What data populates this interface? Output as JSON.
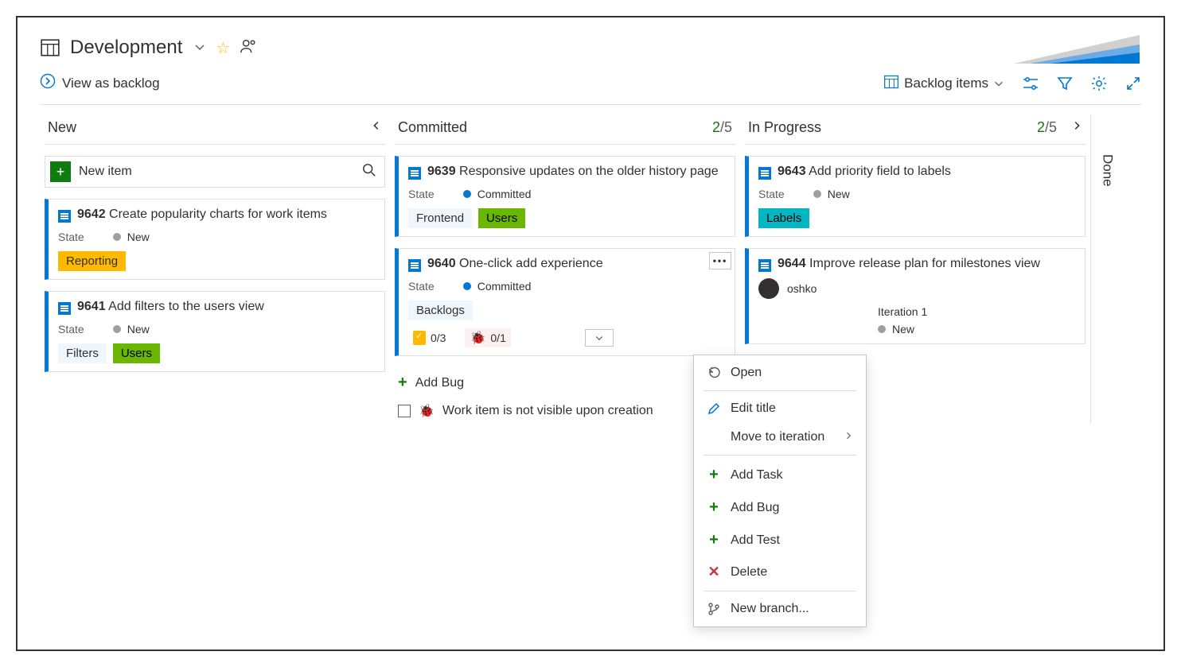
{
  "header": {
    "title": "Development",
    "view_as_backlog": "View as backlog",
    "backlog_selector": "Backlog items"
  },
  "columns": {
    "new": {
      "title": "New",
      "new_item_label": "New item",
      "cards": [
        {
          "id": "9642",
          "title": "Create popularity charts for work items",
          "state_label": "State",
          "state_value": "New",
          "tags": [
            {
              "text": "Reporting",
              "cls": "yellow"
            }
          ]
        },
        {
          "id": "9641",
          "title": "Add filters to the users view",
          "state_label": "State",
          "state_value": "New",
          "tags": [
            {
              "text": "Filters",
              "cls": "blue-lite"
            },
            {
              "text": "Users",
              "cls": "green"
            }
          ]
        }
      ]
    },
    "committed": {
      "title": "Committed",
      "count": "2",
      "limit": "/5",
      "cards": [
        {
          "id": "9639",
          "title": "Responsive updates on the older history page",
          "state_label": "State",
          "state_value": "Committed",
          "tags": [
            {
              "text": "Frontend",
              "cls": "blue-lite"
            },
            {
              "text": "Users",
              "cls": "green"
            }
          ]
        },
        {
          "id": "9640",
          "title": "One-click add experience",
          "state_label": "State",
          "state_value": "Committed",
          "tags": [
            {
              "text": "Backlogs",
              "cls": "blue-lite"
            }
          ],
          "tasks": "0/3",
          "bugs": "0/1",
          "add_bug": "Add Bug",
          "child_text": "Work item is not visible upon creation"
        }
      ]
    },
    "in_progress": {
      "title": "In Progress",
      "count": "2",
      "limit": "/5",
      "cards": [
        {
          "id": "9643",
          "title": "Add priority field to labels",
          "state_label": "State",
          "state_value": "New",
          "tags": [
            {
              "text": "Labels",
              "cls": "cyan"
            }
          ]
        },
        {
          "id": "9644",
          "title": "Improve release plan for milestones view",
          "assignee_partial": "oshko",
          "iteration_label": "Iteration 1",
          "state_value": "New"
        }
      ]
    },
    "done": {
      "title": "Done"
    }
  },
  "menu": {
    "open": "Open",
    "edit": "Edit title",
    "move": "Move to iteration",
    "add_task": "Add Task",
    "add_bug": "Add Bug",
    "add_test": "Add Test",
    "delete": "Delete",
    "branch": "New branch..."
  }
}
